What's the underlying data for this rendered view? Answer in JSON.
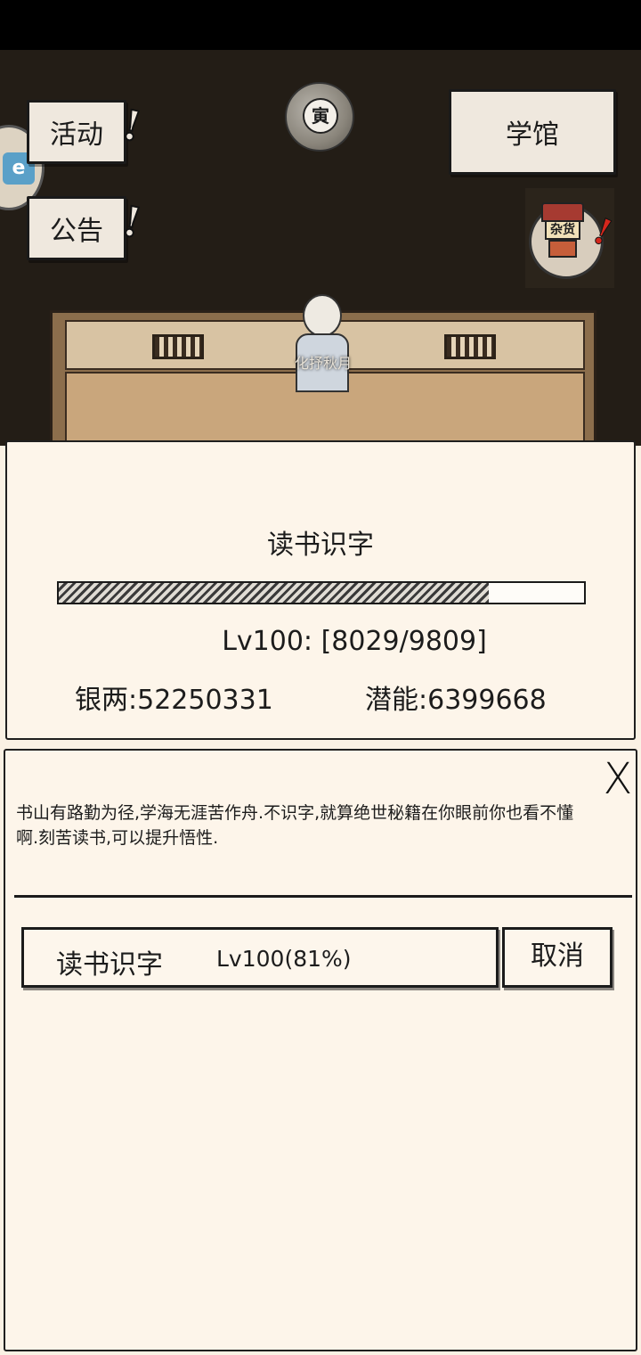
{
  "top_buttons": {
    "activity_label": "活动",
    "notice_label": "公告",
    "academy_label": "学馆"
  },
  "shop": {
    "sign_label": "杂货"
  },
  "npc": {
    "name": "化抒秋月"
  },
  "skill_panel": {
    "title": "读书识字",
    "progress_fraction": 0.8185,
    "level_text": "Lv100:  [8029/9809]",
    "money_text": "银两:52250331",
    "potential_text": "潜能:6399668"
  },
  "detail_panel": {
    "close_label": "X",
    "description": "书山有路勤为径,学海无涯苦作舟.不识字,就算绝世秘籍在你眼前你也看不懂啊.刻苦读书,可以提升悟性.",
    "skill_name": "读书识字",
    "skill_level": "Lv100(81%)",
    "cancel_label": "取消"
  }
}
